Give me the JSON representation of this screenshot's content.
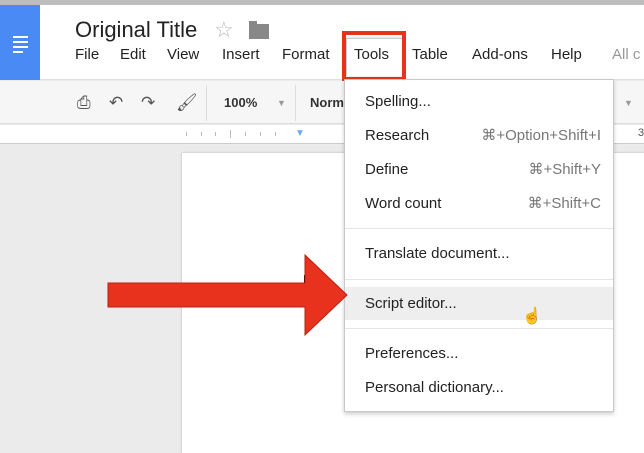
{
  "document": {
    "title": "Original Title"
  },
  "menubar": {
    "items": [
      "File",
      "Edit",
      "View",
      "Insert",
      "Format",
      "Tools",
      "Table",
      "Add-ons",
      "Help"
    ],
    "status": "All c"
  },
  "toolbar": {
    "zoom": "100%",
    "style": "Norm",
    "ruler_number": "3"
  },
  "tools_menu": {
    "items": [
      {
        "label": "Spelling...",
        "shortcut": ""
      },
      {
        "label": "Research",
        "shortcut": "⌘+Option+Shift+I"
      },
      {
        "label": "Define",
        "shortcut": "⌘+Shift+Y"
      },
      {
        "label": "Word count",
        "shortcut": "⌘+Shift+C"
      },
      {
        "label": "Translate document...",
        "shortcut": ""
      },
      {
        "label": "Script editor...",
        "shortcut": ""
      },
      {
        "label": "Preferences...",
        "shortcut": ""
      },
      {
        "label": "Personal dictionary...",
        "shortcut": ""
      }
    ],
    "highlighted": "Script editor..."
  },
  "colors": {
    "accent": "#4a8af4",
    "annotation": "#e8321e"
  }
}
